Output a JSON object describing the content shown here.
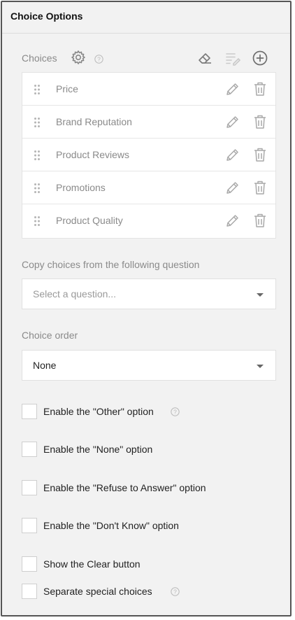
{
  "panel": {
    "title": "Choice Options"
  },
  "choices": {
    "label": "Choices",
    "items": [
      {
        "label": "Price"
      },
      {
        "label": "Brand Reputation"
      },
      {
        "label": "Product Reviews"
      },
      {
        "label": "Promotions"
      },
      {
        "label": "Product Quality"
      }
    ]
  },
  "copy_choices": {
    "label": "Copy choices from the following question",
    "placeholder": "Select a question..."
  },
  "choice_order": {
    "label": "Choice order",
    "value": "None"
  },
  "options": [
    {
      "label": "Enable the \"Other\" option",
      "checked": false,
      "help": true
    },
    {
      "label": "Enable the \"None\" option",
      "checked": false,
      "help": false
    },
    {
      "label": "Enable the \"Refuse to Answer\" option",
      "checked": false,
      "help": false
    },
    {
      "label": "Enable the \"Don't Know\" option",
      "checked": false,
      "help": false
    },
    {
      "label": "Show the Clear button",
      "checked": false,
      "help": false
    },
    {
      "label": "Separate special choices",
      "checked": false,
      "help": true
    }
  ],
  "icons": {
    "settings": "gear-icon",
    "help": "help-circle-icon",
    "clear": "eraser-icon",
    "bulk_edit": "list-edit-icon",
    "add": "plus-circle-icon",
    "drag": "drag-handle-icon",
    "edit": "pencil-icon",
    "delete": "trash-icon"
  },
  "colors": {
    "panel_bg": "#f2f2f2",
    "muted_text": "#8a8a8a",
    "body_text": "#222222",
    "icon": "#9a9a9a"
  }
}
